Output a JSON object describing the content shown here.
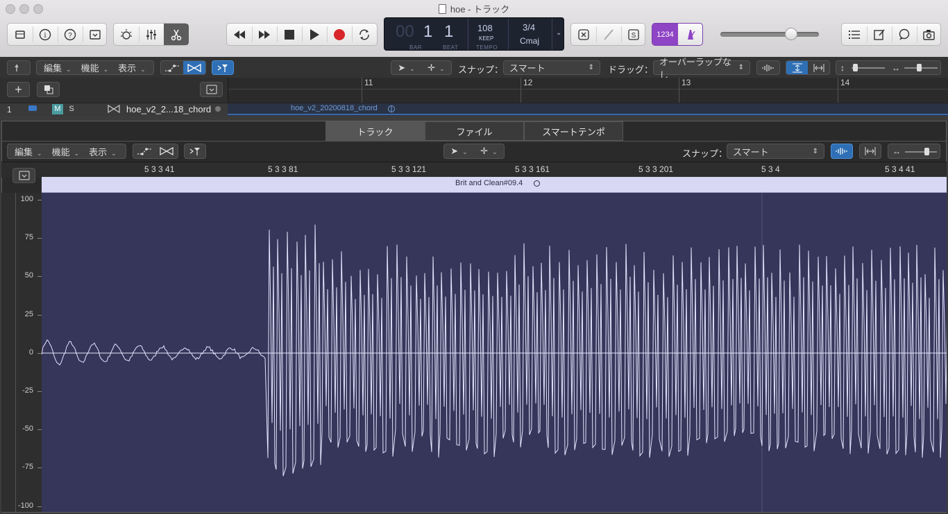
{
  "window": {
    "title": "hoe - トラック"
  },
  "control_bar": {
    "left_icons": [
      "library-icon",
      "info-icon",
      "help-icon",
      "toolbar-icon",
      "smart-controls-icon",
      "mixer-icon",
      "editors-icon"
    ],
    "transport": [
      "rewind-icon",
      "forward-icon",
      "stop-icon",
      "play-icon",
      "record-icon",
      "cycle-icon"
    ],
    "lcd": {
      "bar_dim": "00",
      "bar": "1",
      "beat": "1",
      "bar_label": "BAR",
      "beat_label": "BEAT",
      "tempo": "108",
      "keep": "KEEP",
      "tempo_label": "TEMPO",
      "signature": "3/4",
      "key": "Cmaj"
    },
    "count_in": "1234",
    "right_icons": [
      "list-editors-icon",
      "note-pad-icon",
      "loop-browser-icon",
      "media-browser-icon"
    ],
    "volume": 0.75,
    "accent": "#8e44c4"
  },
  "tracks_toolbar": {
    "menus": [
      "編集",
      "機能",
      "表示"
    ],
    "snap_label": "スナップ：",
    "snap_value": "スマート",
    "drag_label": "ドラッグ：",
    "drag_value": "オーバーラップなし"
  },
  "ruler": {
    "bars": [
      "11",
      "12",
      "13",
      "14"
    ]
  },
  "track": {
    "number": "1",
    "m": "M",
    "s": "S",
    "name": "hoe_v2_2...18_chord",
    "region": "hoe_v2_20200818_chord"
  },
  "editor": {
    "tabs": [
      "トラック",
      "ファイル",
      "スマートテンポ"
    ],
    "menus": [
      "編集",
      "機能",
      "表示"
    ],
    "snap_label": "スナップ：",
    "snap_value": "スマート",
    "ruler": [
      "5 3 3 41",
      "5 3 3 81",
      "5 3 3 121",
      "5 3 3 161",
      "5 3 3 201",
      "5 3 4",
      "5 3 4 41"
    ],
    "region_name": "Brit and Clean#09.4",
    "amplitude_ticks": [
      "100",
      "75",
      "50",
      "25",
      "0",
      "-25",
      "-50",
      "-75",
      "-100"
    ],
    "wave_color": "#e6e6ff",
    "bg_color": "#36355a"
  }
}
